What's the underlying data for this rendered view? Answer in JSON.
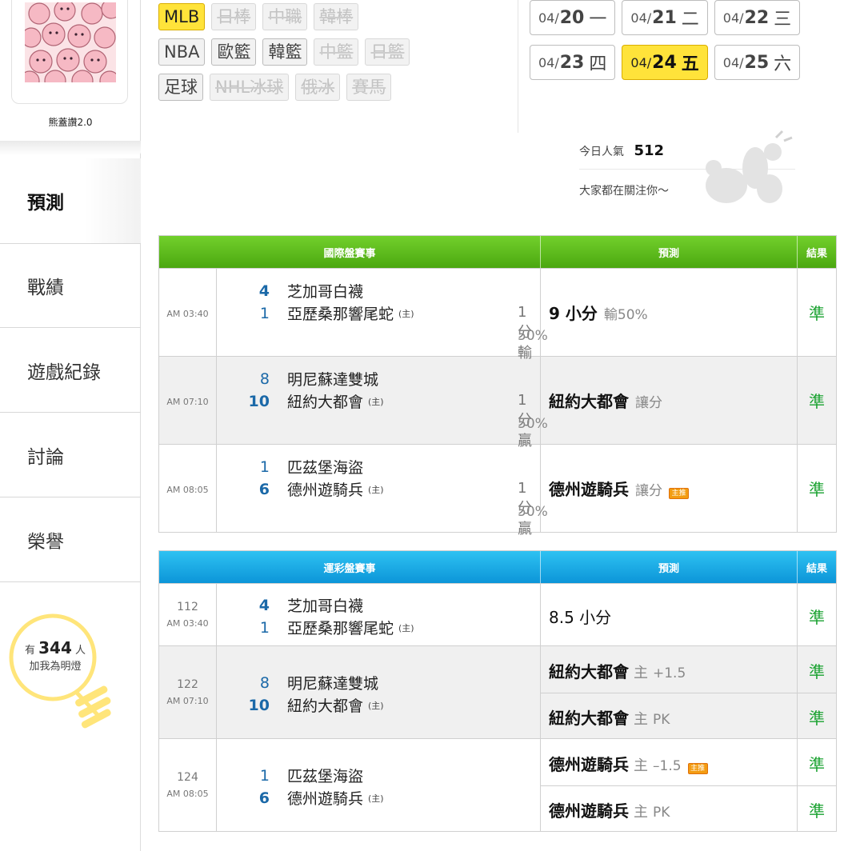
{
  "user": {
    "name": "熊蓋讚2.0"
  },
  "nav": {
    "items": [
      "預測",
      "戰績",
      "遊戲紀錄",
      "討論",
      "榮譽"
    ]
  },
  "fans": {
    "prefix": "有",
    "count": "344",
    "suffix": "人",
    "label": "加我為明燈"
  },
  "filters": {
    "rows": [
      [
        {
          "label": "MLB",
          "state": "active"
        },
        {
          "label": "日棒",
          "state": "disabled"
        },
        {
          "label": "中職",
          "state": "disabled"
        },
        {
          "label": "韓棒",
          "state": "disabled"
        }
      ],
      [
        {
          "label": "NBA",
          "state": "normal"
        },
        {
          "label": "歐籃",
          "state": "normal"
        },
        {
          "label": "韓籃",
          "state": "normal"
        },
        {
          "label": "中籃",
          "state": "disabled"
        },
        {
          "label": "日籃",
          "state": "disabled"
        }
      ],
      [
        {
          "label": "足球",
          "state": "normal"
        },
        {
          "label": "NHL冰球",
          "state": "disabled"
        },
        {
          "label": "俄冰",
          "state": "disabled"
        },
        {
          "label": "賽馬",
          "state": "disabled"
        }
      ]
    ]
  },
  "dates": {
    "rows": [
      [
        {
          "md": "04/",
          "d": "20",
          "w": "一",
          "active": false
        },
        {
          "md": "04/",
          "d": "21",
          "w": "二",
          "active": false
        },
        {
          "md": "04/",
          "d": "22",
          "w": "三",
          "active": false
        }
      ],
      [
        {
          "md": "04/",
          "d": "23",
          "w": "四",
          "active": false
        },
        {
          "md": "04/",
          "d": "24",
          "w": "五",
          "active": true
        },
        {
          "md": "04/",
          "d": "25",
          "w": "六",
          "active": false
        }
      ]
    ]
  },
  "popularity": {
    "label": "今日人氣",
    "count": "512",
    "subtitle": "大家都在關注你～"
  },
  "intl_table": {
    "headers": {
      "event": "國際盤賽事",
      "prediction": "預測",
      "result": "結果"
    },
    "rows": [
      {
        "time": "AM 03:40",
        "away_score": "4",
        "away": "芝加哥白襪",
        "home_score": "1",
        "home": "亞歷桑那響尾蛇",
        "home_mark": "(主)",
        "spread": "1分輸",
        "pct": "50%",
        "pred_main": "9 小分",
        "pred_sub": "輸50%",
        "badge": "",
        "result": "準"
      },
      {
        "time": "AM 07:10",
        "away_score": "8",
        "away": "明尼蘇達雙城",
        "home_score": "10",
        "home": "紐約大都會",
        "home_mark": "(主)",
        "spread": "1分贏",
        "pct": "50%",
        "pred_main": "紐約大都會",
        "pred_sub": "讓分",
        "badge": "",
        "result": "準"
      },
      {
        "time": "AM 08:05",
        "away_score": "1",
        "away": "匹茲堡海盜",
        "home_score": "6",
        "home": "德州遊騎兵",
        "home_mark": "(主)",
        "spread": "1分贏",
        "pct": "50%",
        "pred_main": "德州遊騎兵",
        "pred_sub": "讓分",
        "badge": "主推",
        "result": "準"
      }
    ]
  },
  "lottery_table": {
    "headers": {
      "event": "運彩盤賽事",
      "prediction": "預測",
      "result": "結果"
    },
    "rows": [
      {
        "code": "112",
        "time": "AM 03:40",
        "away_score": "4",
        "away": "芝加哥白襪",
        "home_score": "1",
        "home": "亞歷桑那響尾蛇",
        "home_mark": "(主)",
        "preds": [
          {
            "main": "8.5 小分",
            "mark": "",
            "line": "",
            "badge": "",
            "result": "準"
          }
        ]
      },
      {
        "code": "122",
        "time": "AM 07:10",
        "away_score": "8",
        "away": "明尼蘇達雙城",
        "home_score": "10",
        "home": "紐約大都會",
        "home_mark": "(主)",
        "preds": [
          {
            "main": "紐約大都會",
            "mark": "主",
            "line": "+1.5",
            "badge": "",
            "result": "準"
          },
          {
            "main": "紐約大都會",
            "mark": "主",
            "line": "PK",
            "badge": "",
            "result": "準"
          }
        ]
      },
      {
        "code": "124",
        "time": "AM 08:05",
        "away_score": "1",
        "away": "匹茲堡海盜",
        "home_score": "6",
        "home": "德州遊騎兵",
        "home_mark": "(主)",
        "preds": [
          {
            "main": "德州遊騎兵",
            "mark": "主",
            "line": "–1.5",
            "badge": "主推",
            "result": "準"
          },
          {
            "main": "德州遊騎兵",
            "mark": "主",
            "line": "PK",
            "badge": "",
            "result": "準"
          }
        ]
      }
    ]
  },
  "colors": {
    "accent_yellow": "#ffe33a",
    "green_header": "#5cbc1c",
    "blue_header": "#1aa8e6",
    "result_green": "#1aa230",
    "score_blue": "#1b69a8"
  }
}
